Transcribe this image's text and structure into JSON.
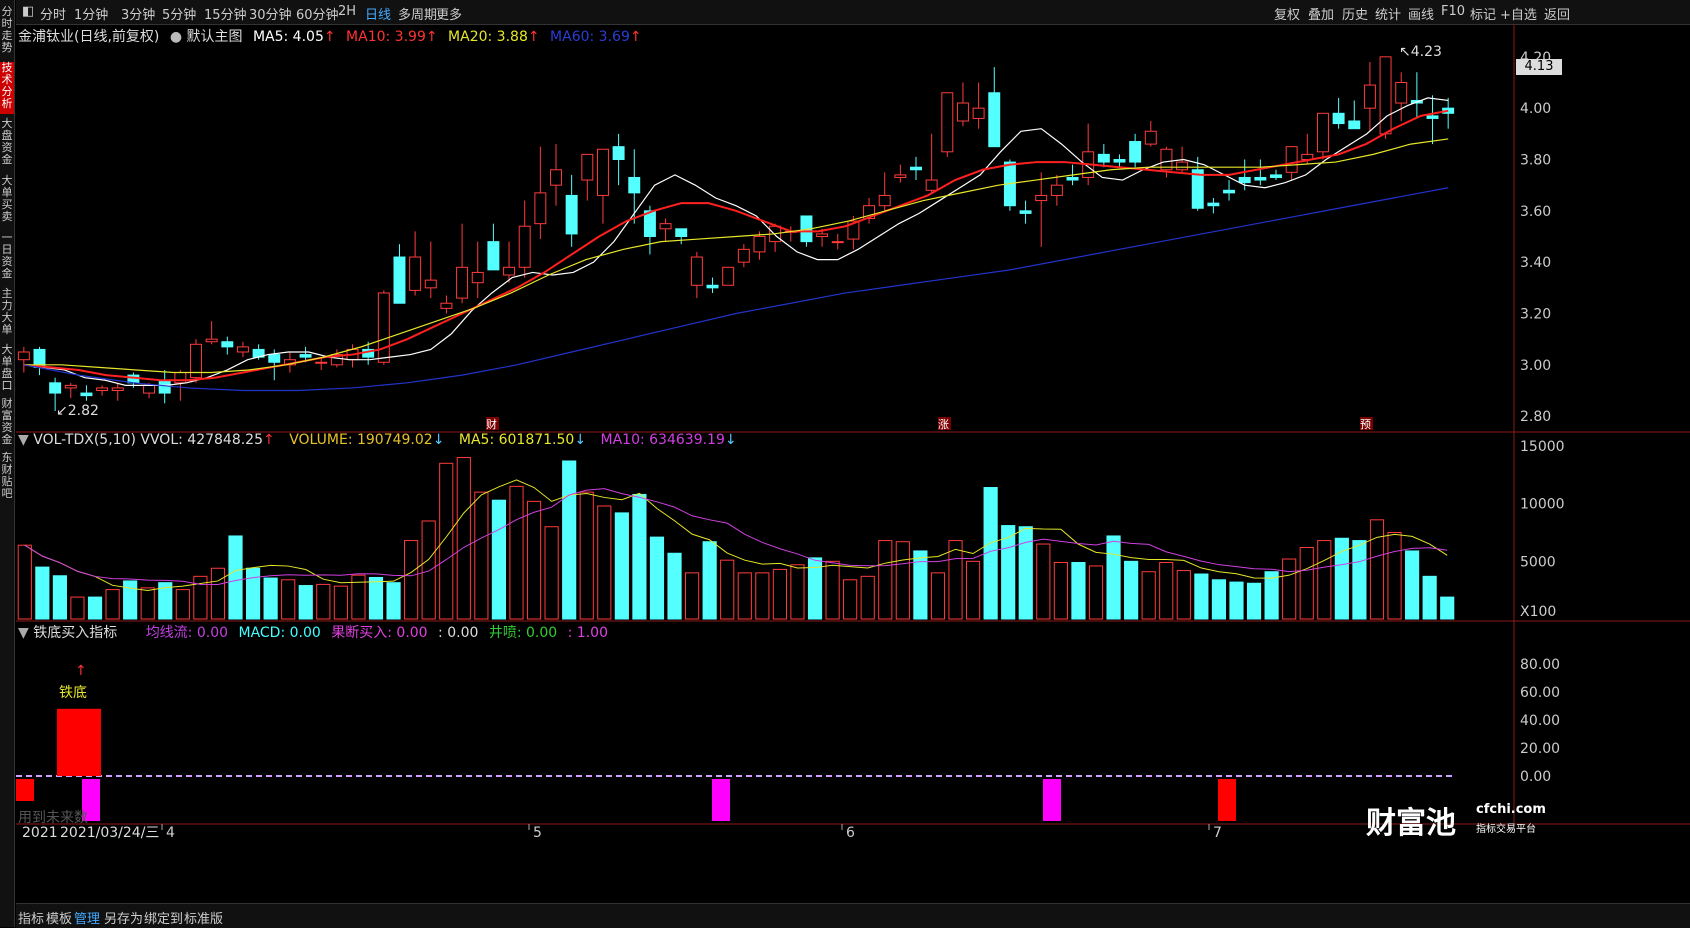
{
  "left_rail": {
    "tabs": [
      "分时走势",
      "技术分析",
      "大盘资金",
      "大单买卖",
      "一日资金",
      "主力大单",
      "大单盘口",
      "财富资金",
      "东财贴吧"
    ]
  },
  "toolbar": {
    "periods": [
      "分时",
      "1分钟",
      "3分钟",
      "5分钟",
      "15分钟",
      "30分钟",
      "60分钟",
      "2H",
      "日线",
      "多周期",
      "更多"
    ],
    "active_period": "日线",
    "right_items": [
      "复权",
      "叠加",
      "历史",
      "统计",
      "画线",
      "F10",
      "标记",
      "+自选",
      "返回"
    ]
  },
  "main_chart": {
    "title": "金浦钛业(日线,前复权)",
    "template": "默认主图",
    "ma5": "MA5: 4.05",
    "ma10": "MA10: 3.99",
    "ma20": "MA20: 3.88",
    "ma60": "MA60: 3.69",
    "high_label": "4.23",
    "low_label": "2.82",
    "current_price": "4.13",
    "y_ticks": [
      "4.20",
      "4.00",
      "3.80",
      "3.60",
      "3.40",
      "3.20",
      "3.00",
      "2.80"
    ],
    "event_markers": [
      "财",
      "涨",
      "预"
    ],
    "colors": {
      "up": "#ff3b3b",
      "down": "#54ffff",
      "ma5": "#ffffff",
      "ma10": "#ff2020",
      "ma20": "#e6e62a",
      "ma60": "#2233cc"
    }
  },
  "volume_chart": {
    "indicator": "VOL-TDX(5,10)",
    "vvol": "VVOL: 427848.25",
    "volume": "VOLUME: 190749.02",
    "ma5": "MA5: 601871.50",
    "ma10": "MA10: 634639.19",
    "y_ticks": [
      "15000",
      "10000",
      "5000"
    ],
    "unit": "X100"
  },
  "indicator_chart": {
    "name": "铁底买入指标",
    "fields": [
      "均线流: 0.00",
      "MACD: 0.00",
      "果断买入: 0.00",
      ": 0.00",
      "井喷: 0.00",
      ": 1.00"
    ],
    "signal_label": "铁底",
    "y_ticks": [
      "80.00",
      "60.00",
      "40.00",
      "20.00",
      "0.00"
    ],
    "watermark": "用到未来数"
  },
  "date_axis": {
    "cursor_date": "2021/03/24/三",
    "start_prefix": "2021",
    "months": [
      "4",
      "5",
      "6",
      "7"
    ]
  },
  "bottom_bar": {
    "items": [
      "指标",
      "模板",
      "管理",
      "另存为",
      "绑定到",
      "标准版"
    ],
    "active": "管理"
  },
  "logo": {
    "text": "财富池",
    "site": "cfchi.com",
    "tagline": "指标交易平台"
  },
  "chart_data": {
    "type": "candlestick",
    "ohlc": [
      [
        3.02,
        3.07,
        2.97,
        3.05
      ],
      [
        3.06,
        3.07,
        2.96,
        2.99
      ],
      [
        2.93,
        2.95,
        2.82,
        2.89
      ],
      [
        2.91,
        2.93,
        2.87,
        2.92
      ],
      [
        2.89,
        2.92,
        2.86,
        2.88
      ],
      [
        2.9,
        2.92,
        2.88,
        2.91
      ],
      [
        2.9,
        2.93,
        2.86,
        2.91
      ],
      [
        2.96,
        2.97,
        2.91,
        2.93
      ],
      [
        2.89,
        2.93,
        2.87,
        2.92
      ],
      [
        2.94,
        2.98,
        2.85,
        2.89
      ],
      [
        2.93,
        2.98,
        2.86,
        2.97
      ],
      [
        2.95,
        3.1,
        2.93,
        3.08
      ],
      [
        3.09,
        3.17,
        3.08,
        3.1
      ],
      [
        3.09,
        3.11,
        3.04,
        3.07
      ],
      [
        3.05,
        3.09,
        3.03,
        3.07
      ],
      [
        3.06,
        3.08,
        3.02,
        3.03
      ],
      [
        3.04,
        3.06,
        2.94,
        3.01
      ],
      [
        3.0,
        3.05,
        2.97,
        3.02
      ],
      [
        3.04,
        3.07,
        3.01,
        3.03
      ],
      [
        3.01,
        3.03,
        2.98,
        3.01
      ],
      [
        3.0,
        3.06,
        2.99,
        3.04
      ],
      [
        3.02,
        3.08,
        2.99,
        3.06
      ],
      [
        3.06,
        3.09,
        3.0,
        3.03
      ],
      [
        3.01,
        3.29,
        3.0,
        3.28
      ],
      [
        3.42,
        3.47,
        3.24,
        3.24
      ],
      [
        3.29,
        3.52,
        3.27,
        3.42
      ],
      [
        3.3,
        3.48,
        3.26,
        3.33
      ],
      [
        3.22,
        3.27,
        3.2,
        3.24
      ],
      [
        3.26,
        3.55,
        3.24,
        3.38
      ],
      [
        3.32,
        3.48,
        3.26,
        3.36
      ],
      [
        3.48,
        3.55,
        3.44,
        3.37
      ],
      [
        3.35,
        3.48,
        3.32,
        3.38
      ],
      [
        3.38,
        3.64,
        3.34,
        3.54
      ],
      [
        3.55,
        3.85,
        3.49,
        3.67
      ],
      [
        3.7,
        3.86,
        3.62,
        3.76
      ],
      [
        3.66,
        3.74,
        3.46,
        3.51
      ],
      [
        3.72,
        3.73,
        3.64,
        3.82
      ],
      [
        3.66,
        3.82,
        3.55,
        3.84
      ],
      [
        3.85,
        3.9,
        3.7,
        3.8
      ],
      [
        3.73,
        3.84,
        3.55,
        3.67
      ],
      [
        3.6,
        3.62,
        3.43,
        3.5
      ],
      [
        3.53,
        3.57,
        3.48,
        3.55
      ],
      [
        3.53,
        3.5,
        3.47,
        3.5
      ],
      [
        3.31,
        3.44,
        3.26,
        3.42
      ],
      [
        3.31,
        3.34,
        3.28,
        3.3
      ],
      [
        3.31,
        3.37,
        3.31,
        3.38
      ],
      [
        3.4,
        3.47,
        3.38,
        3.45
      ],
      [
        3.44,
        3.52,
        3.41,
        3.5
      ],
      [
        3.48,
        3.55,
        3.44,
        3.54
      ],
      [
        3.52,
        3.54,
        3.48,
        3.52
      ],
      [
        3.58,
        3.58,
        3.46,
        3.48
      ],
      [
        3.5,
        3.53,
        3.46,
        3.51
      ],
      [
        3.48,
        3.51,
        3.45,
        3.48
      ],
      [
        3.49,
        3.58,
        3.45,
        3.56
      ],
      [
        3.57,
        3.65,
        3.55,
        3.62
      ],
      [
        3.62,
        3.75,
        3.6,
        3.66
      ],
      [
        3.73,
        3.78,
        3.71,
        3.74
      ],
      [
        3.77,
        3.81,
        3.72,
        3.76
      ],
      [
        3.68,
        3.9,
        3.67,
        3.72
      ],
      [
        3.83,
        4.06,
        3.81,
        4.06
      ],
      [
        3.95,
        4.1,
        3.93,
        4.02
      ],
      [
        3.96,
        4.1,
        3.92,
        4.0
      ],
      [
        4.06,
        4.16,
        3.95,
        3.85
      ],
      [
        3.79,
        3.8,
        3.6,
        3.62
      ],
      [
        3.6,
        3.64,
        3.55,
        3.59
      ],
      [
        3.64,
        3.75,
        3.46,
        3.66
      ],
      [
        3.66,
        3.74,
        3.62,
        3.7
      ],
      [
        3.73,
        3.78,
        3.7,
        3.72
      ],
      [
        3.73,
        3.94,
        3.7,
        3.83
      ],
      [
        3.82,
        3.86,
        3.77,
        3.79
      ],
      [
        3.8,
        3.82,
        3.77,
        3.79
      ],
      [
        3.87,
        3.9,
        3.77,
        3.79
      ],
      [
        3.86,
        3.95,
        3.85,
        3.91
      ],
      [
        3.76,
        3.85,
        3.73,
        3.84
      ],
      [
        3.76,
        3.85,
        3.75,
        3.79
      ],
      [
        3.76,
        3.81,
        3.6,
        3.61
      ],
      [
        3.63,
        3.65,
        3.59,
        3.62
      ],
      [
        3.68,
        3.72,
        3.64,
        3.67
      ],
      [
        3.73,
        3.8,
        3.68,
        3.71
      ],
      [
        3.73,
        3.8,
        3.7,
        3.72
      ],
      [
        3.74,
        3.76,
        3.72,
        3.73
      ],
      [
        3.75,
        3.82,
        3.72,
        3.85
      ],
      [
        3.8,
        3.9,
        3.78,
        3.82
      ],
      [
        3.83,
        3.94,
        3.8,
        3.98
      ],
      [
        3.98,
        4.04,
        3.92,
        3.94
      ],
      [
        3.95,
        4.03,
        3.93,
        3.92
      ],
      [
        4.0,
        4.18,
        3.91,
        4.09
      ],
      [
        3.9,
        4.19,
        3.88,
        4.2
      ],
      [
        4.02,
        4.14,
        3.95,
        4.1
      ],
      [
        4.03,
        4.14,
        3.96,
        4.02
      ],
      [
        3.97,
        4.05,
        3.86,
        3.96
      ],
      [
        4.0,
        4.04,
        3.92,
        3.98
      ]
    ],
    "volume": [
      6400,
      4500,
      3750,
      1900,
      1900,
      2550,
      3300,
      2700,
      3150,
      2550,
      3700,
      4400,
      7200,
      4400,
      3550,
      3400,
      2900,
      3000,
      2850,
      3800,
      3600,
      3150,
      6800,
      8500,
      13500,
      14000,
      11000,
      10300,
      11500,
      10200,
      8000,
      13700,
      11000,
      9800,
      9200,
      10800,
      7100,
      5700,
      4000,
      6700,
      5100,
      4000,
      4000,
      4300,
      4700,
      5300,
      5000,
      3400,
      3700,
      6800,
      6700,
      5900,
      4000,
      6800,
      5000,
      11400,
      8100,
      8000,
      6500,
      4900,
      4900,
      4600,
      7200,
      5000,
      4100,
      4900,
      4200,
      3900,
      3400,
      3200,
      3100,
      4100,
      5200,
      6200,
      6800,
      7000,
      6800,
      8600,
      7500,
      5900,
      3700,
      1900
    ],
    "ma_lines": {
      "MA5": [
        3.0,
        2.99,
        2.98,
        2.95,
        2.94,
        2.92,
        2.92,
        2.92,
        2.93,
        2.95,
        2.98,
        3.02,
        3.04,
        3.05,
        3.05,
        3.03,
        3.02,
        3.02,
        3.03,
        3.04,
        3.06,
        3.12,
        3.21,
        3.28,
        3.34,
        3.36,
        3.35,
        3.36,
        3.4,
        3.48,
        3.59,
        3.7,
        3.74,
        3.7,
        3.65,
        3.62,
        3.58,
        3.5,
        3.44,
        3.41,
        3.41,
        3.45,
        3.5,
        3.55,
        3.59,
        3.64,
        3.69,
        3.74,
        3.83,
        3.91,
        3.92,
        3.86,
        3.79,
        3.73,
        3.72,
        3.76,
        3.79,
        3.8,
        3.78,
        3.74,
        3.7,
        3.69,
        3.71,
        3.74,
        3.8,
        3.85,
        3.9,
        3.97,
        4.01,
        4.04,
        4.03
      ],
      "MA10": [
        3.0,
        2.99,
        2.98,
        2.96,
        2.95,
        2.94,
        2.94,
        2.95,
        2.97,
        2.99,
        3.01,
        3.03,
        3.04,
        3.06,
        3.1,
        3.15,
        3.2,
        3.25,
        3.3,
        3.36,
        3.43,
        3.5,
        3.56,
        3.6,
        3.63,
        3.63,
        3.6,
        3.56,
        3.52,
        3.52,
        3.54,
        3.58,
        3.62,
        3.66,
        3.72,
        3.76,
        3.78,
        3.79,
        3.79,
        3.78,
        3.77,
        3.76,
        3.75,
        3.74,
        3.74,
        3.76,
        3.78,
        3.8,
        3.82,
        3.86,
        3.92,
        3.97,
        3.99
      ],
      "MA20": [
        3.0,
        3.0,
        2.99,
        2.98,
        2.97,
        2.97,
        2.98,
        3.0,
        3.03,
        3.07,
        3.12,
        3.17,
        3.22,
        3.28,
        3.35,
        3.41,
        3.45,
        3.48,
        3.49,
        3.5,
        3.51,
        3.53,
        3.56,
        3.6,
        3.64,
        3.67,
        3.7,
        3.72,
        3.74,
        3.76,
        3.77,
        3.77,
        3.77,
        3.77,
        3.78,
        3.79,
        3.82,
        3.86,
        3.88
      ],
      "MA60": [
        3.0,
        2.96,
        2.93,
        2.91,
        2.9,
        2.9,
        2.91,
        2.93,
        2.96,
        3.0,
        3.05,
        3.1,
        3.15,
        3.2,
        3.24,
        3.28,
        3.31,
        3.34,
        3.37,
        3.41,
        3.45,
        3.49,
        3.53,
        3.57,
        3.61,
        3.65,
        3.69
      ]
    },
    "ylim": [
      2.75,
      4.25
    ],
    "volume_ylim": [
      0,
      15000
    ],
    "indicator_ylim": [
      0,
      100
    ],
    "signal_values": [
      {
        "index": 3,
        "value": 48
      }
    ]
  }
}
